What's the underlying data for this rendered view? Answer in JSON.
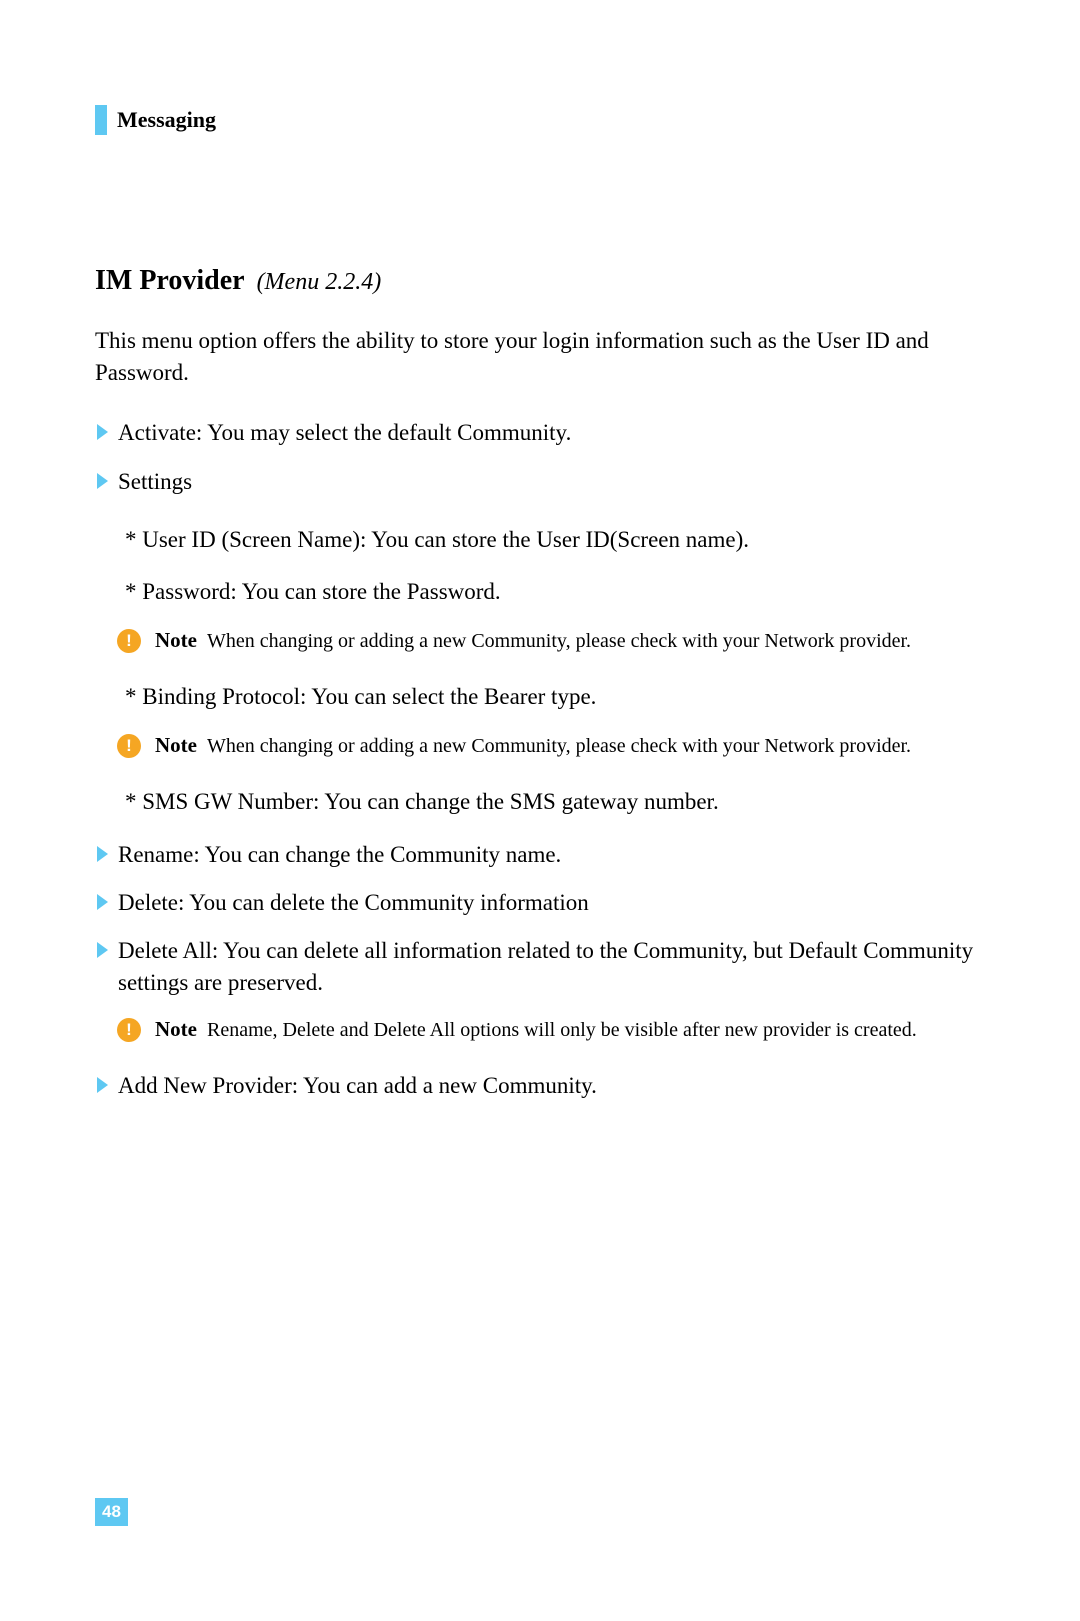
{
  "section_title": "Messaging",
  "heading": {
    "main": "IM Provider",
    "menu": "(Menu 2.2.4)"
  },
  "intro": "This menu option offers the ability to store your login information such as the User ID and Password.",
  "bullets": {
    "activate": "Activate: You may select the default Community.",
    "settings": "Settings",
    "rename": "Rename: You can change the Community name.",
    "delete": "Delete: You can delete the Community information",
    "delete_all": "Delete All: You can delete all information related to the Community, but Default Community settings are preserved.",
    "add_new": "Add New Provider: You can add a new Community."
  },
  "subs": {
    "user_id": "* User ID (Screen Name): You can store the User ID(Screen name).",
    "password": "* Password: You can store the Password.",
    "binding": "* Binding Protocol: You can select the Bearer type.",
    "sms_gw": "* SMS GW Number: You can change the SMS gateway number."
  },
  "notes": {
    "label": "Note",
    "note1": "When changing or adding a new Community, please check with your Network provider.",
    "note2": "When changing or adding a new Community, please check with your Network provider.",
    "note3": "Rename, Delete and Delete All options will only be visible after new provider is created."
  },
  "page_number": "48"
}
